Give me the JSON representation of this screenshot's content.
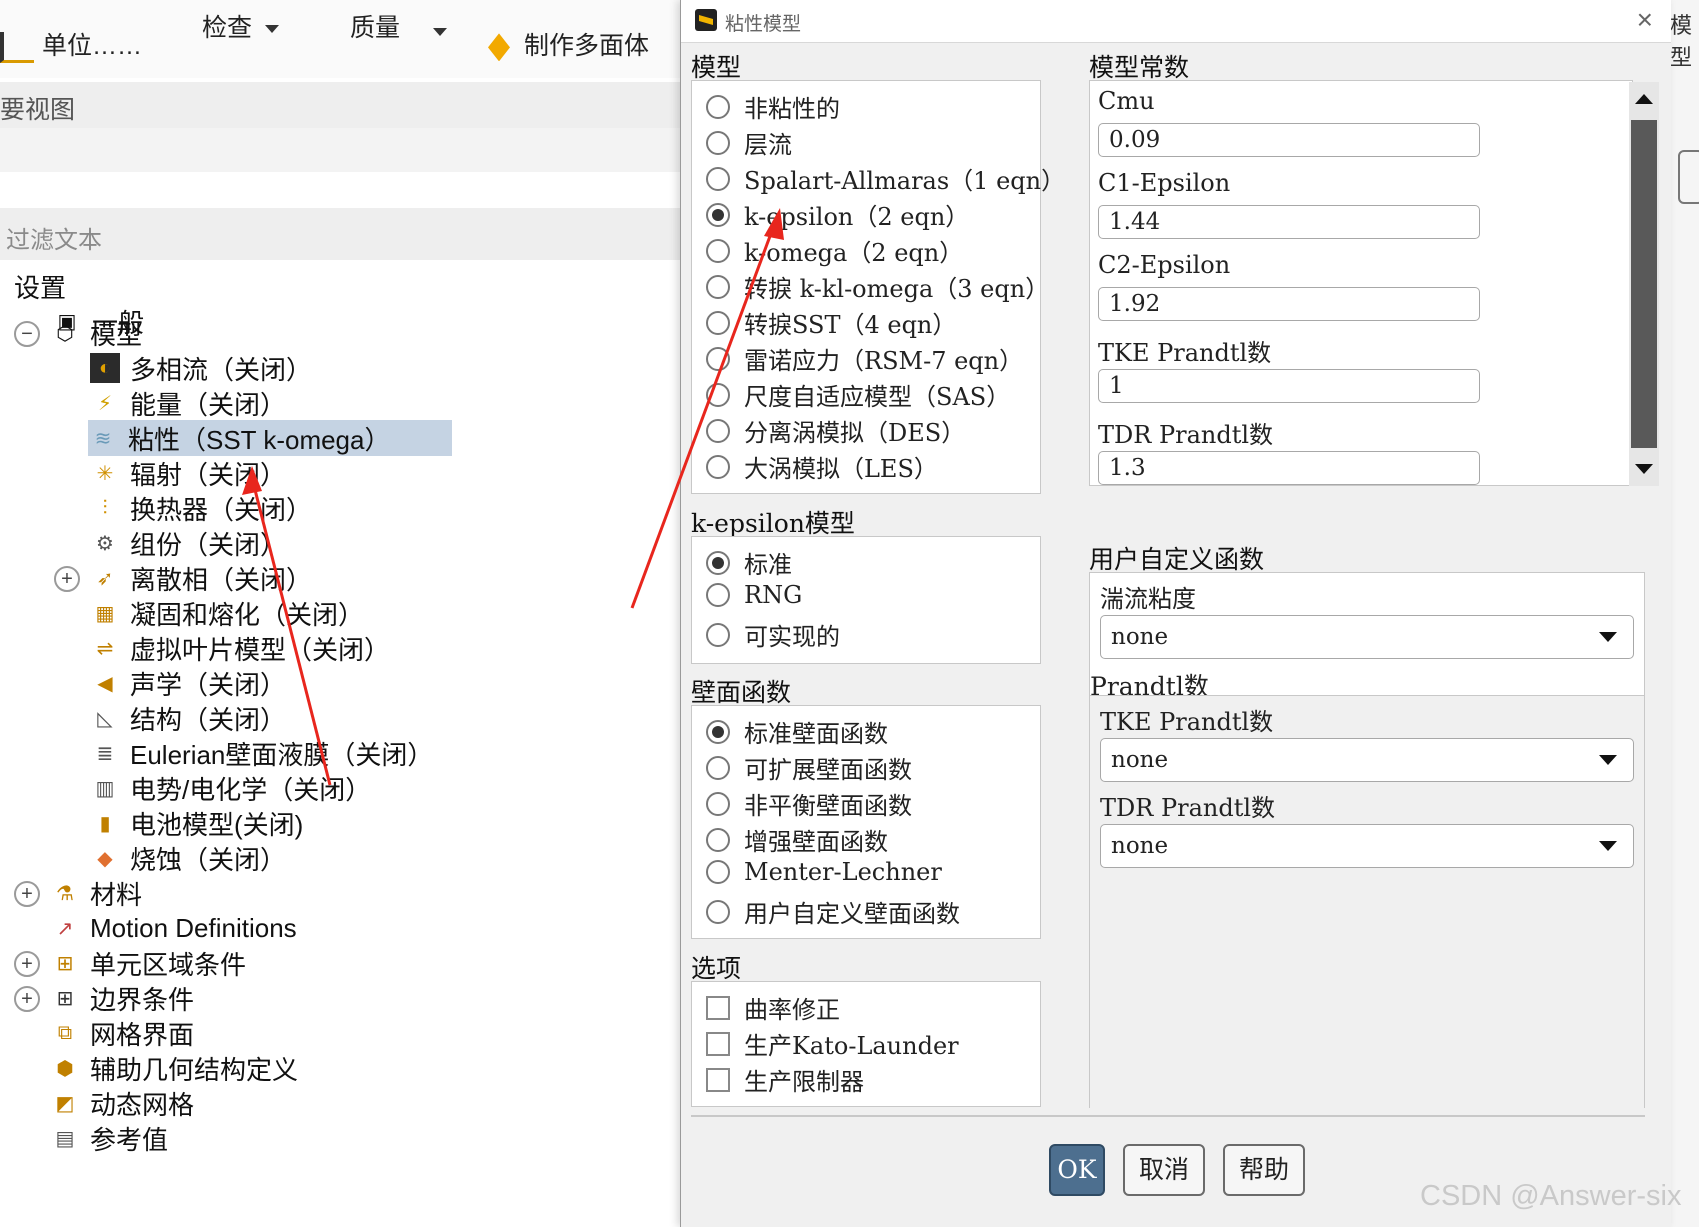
{
  "toolbar": {
    "units": "单位……",
    "check": "检查",
    "quality": "质量",
    "polyhedra": "制作多面体"
  },
  "outline": {
    "title": "要视图",
    "filter_placeholder": "过滤文本"
  },
  "tree": {
    "setup": "设置",
    "general": "一般",
    "models": "模型",
    "model_items": [
      "多相流（关闭）",
      "能量（关闭）",
      "粘性（SST k-omega）",
      "辐射（关闭）",
      "换热器（关闭）",
      "组份（关闭）",
      "离散相（关闭）",
      "凝固和熔化（关闭）",
      "虚拟叶片模型（关闭）",
      "声学（关闭）",
      "结构（关闭）",
      "Eulerian壁面液膜（关闭）",
      "电势/电化学（关闭）",
      "电池模型(关闭)",
      "烧蚀（关闭）"
    ],
    "materials": "材料",
    "motion_definitions": "Motion Definitions",
    "cell_zone": "单元区域条件",
    "boundary": "边界条件",
    "mesh_interfaces": "网格界面",
    "aux_geometry": "辅助几何结构定义",
    "dynamic_mesh": "动态网格",
    "reference": "参考值"
  },
  "right_edge": {
    "tab": "模型"
  },
  "dialog": {
    "title": "粘性模型",
    "model_label": "模型",
    "models": [
      "非粘性的",
      "层流",
      "Spalart-Allmaras（1 eqn）",
      "k-epsilon（2 eqn）",
      "k-omega（2 eqn）",
      "转捩 k-kl-omega（3 eqn）",
      "转捩SST（4 eqn）",
      "雷诺应力（RSM-7 eqn）",
      "尺度自适应模型（SAS）",
      "分离涡模拟（DES）",
      "大涡模拟（LES）"
    ],
    "model_selected_index": 3,
    "constants_label": "模型常数",
    "constants": [
      {
        "label": "Cmu",
        "value": "0.09"
      },
      {
        "label": "C1-Epsilon",
        "value": "1.44"
      },
      {
        "label": "C2-Epsilon",
        "value": "1.92"
      },
      {
        "label": "TKE Prandtl数",
        "value": "1"
      },
      {
        "label": "TDR Prandtl数",
        "value": "1.3"
      }
    ],
    "ke_model_label": "k-epsilon模型",
    "ke_models": [
      "标准",
      "RNG",
      "可实现的"
    ],
    "ke_selected_index": 0,
    "wall_label": "壁面函数",
    "wall_functions": [
      "标准壁面函数",
      "可扩展壁面函数",
      "非平衡壁面函数",
      "增强壁面函数",
      "Menter-Lechner",
      "用户自定义壁面函数"
    ],
    "wall_selected_index": 0,
    "options_label": "选项",
    "options": [
      "曲率修正",
      "生产Kato-Launder",
      "生产限制器"
    ],
    "udf_label": "用户自定义函数",
    "turb_visc_label": "湍流粘度",
    "turb_visc_value": "none",
    "prandtl_label": "Prandtl数",
    "tke_prandtl_label": "TKE Prandtl数",
    "tke_prandtl_value": "none",
    "tdr_prandtl_label": "TDR Prandtl数",
    "tdr_prandtl_value": "none",
    "ok": "OK",
    "cancel": "取消",
    "help": "帮助"
  },
  "watermark": "CSDN @Answer-six",
  "colors": {
    "selection": "#c5d3e3",
    "ok_button": "#4d6f8f",
    "annotation_arrow": "#e8261d"
  }
}
